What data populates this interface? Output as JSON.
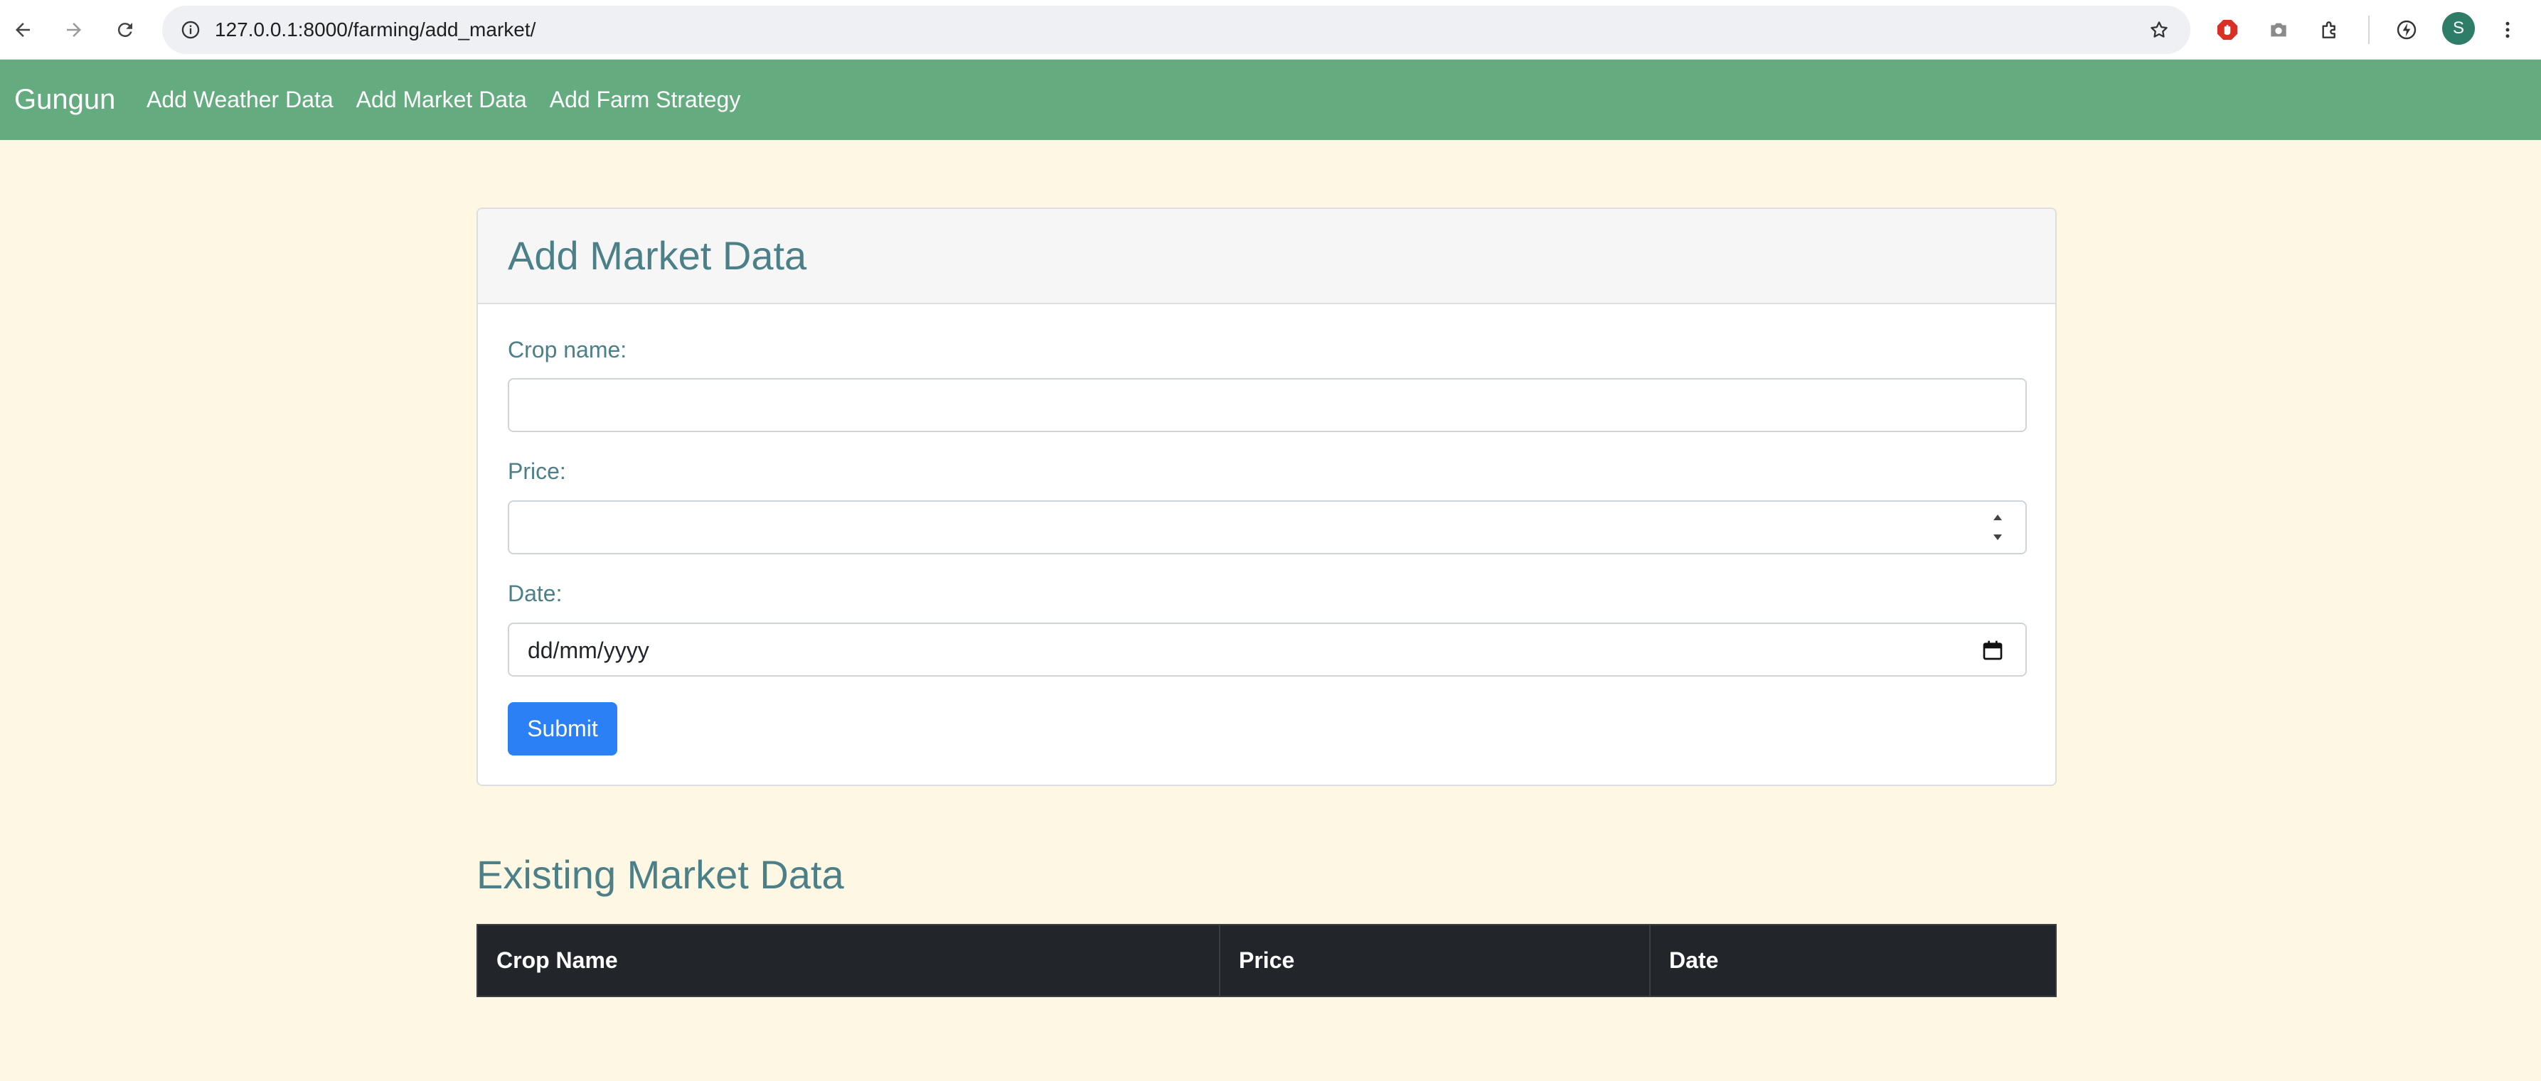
{
  "browser": {
    "url": "127.0.0.1:8000/farming/add_market/",
    "profile_initial": "S",
    "icons": [
      "back-icon",
      "forward-icon",
      "reload-icon",
      "site-info-icon",
      "bookmark-star-icon",
      "adblock-extension-icon",
      "screenshot-extension-icon",
      "extensions-puzzle-icon",
      "performance-icon",
      "menu-kebab-icon"
    ]
  },
  "navbar": {
    "brand": "Gungun",
    "links": [
      "Add Weather Data",
      "Add Market Data",
      "Add Farm Strategy"
    ]
  },
  "form": {
    "title": "Add Market Data",
    "crop_label": "Crop name:",
    "crop_value": "",
    "price_label": "Price:",
    "price_value": "",
    "date_label": "Date:",
    "date_placeholder": "dd/mm/yyyy",
    "submit_label": "Submit"
  },
  "table": {
    "title": "Existing Market Data",
    "columns": [
      "Crop Name",
      "Price",
      "Date"
    ],
    "rows": []
  },
  "colors": {
    "navbar": "#64ac80",
    "page_background": "#fdf7e4",
    "accent_text": "#4b8088",
    "button": "#2a80f4",
    "table_header": "#22262a"
  }
}
